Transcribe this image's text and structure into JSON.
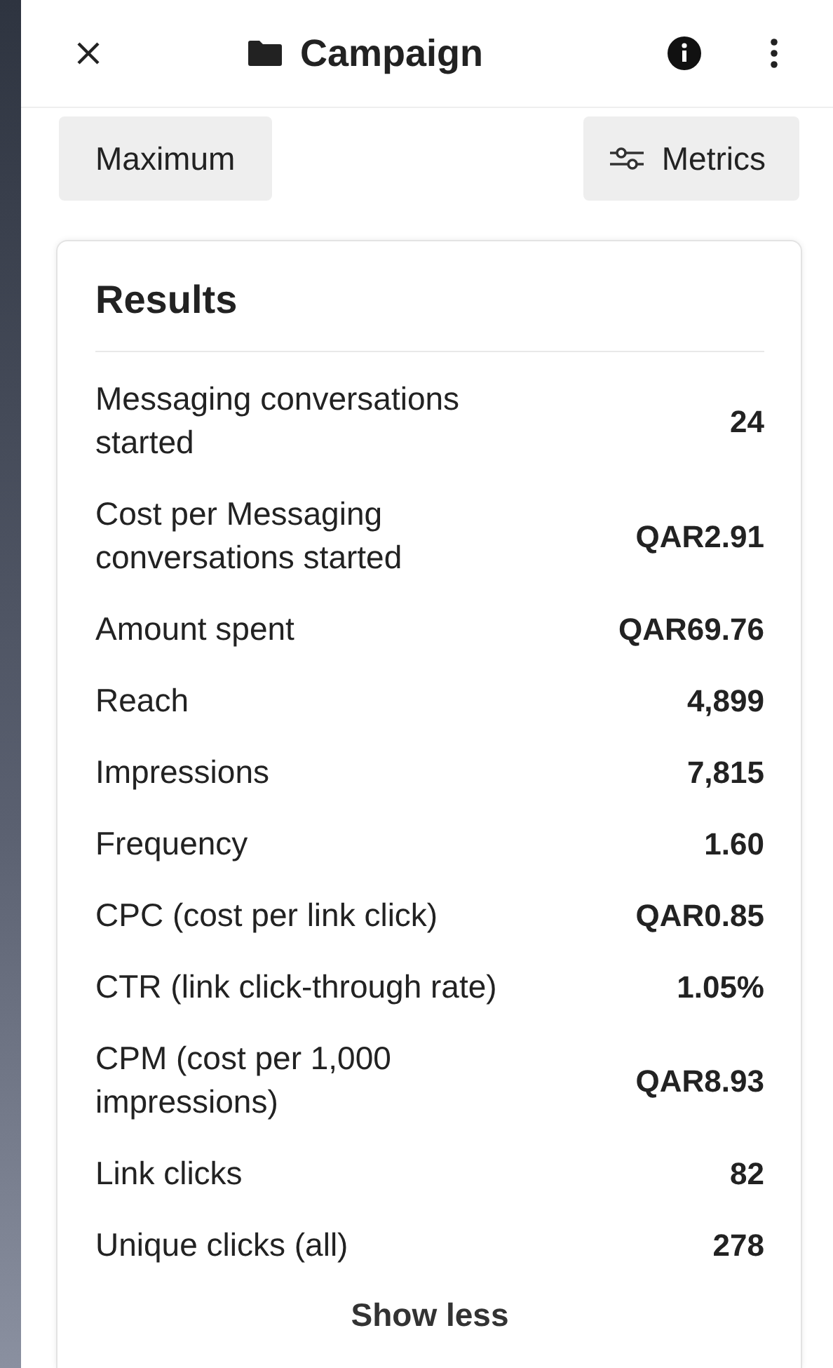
{
  "header": {
    "title": "Campaign"
  },
  "toolbar": {
    "left_button": "Maximum",
    "right_button": "Metrics"
  },
  "results": {
    "title": "Results",
    "rows": [
      {
        "label": "Messaging conversations started",
        "value": "24"
      },
      {
        "label": "Cost per Messaging conversations started",
        "value": "QAR2.91"
      },
      {
        "label": "Amount spent",
        "value": "QAR69.76"
      },
      {
        "label": "Reach",
        "value": "4,899"
      },
      {
        "label": "Impressions",
        "value": "7,815"
      },
      {
        "label": "Frequency",
        "value": "1.60"
      },
      {
        "label": "CPC (cost per link click)",
        "value": "QAR0.85"
      },
      {
        "label": "CTR (link click-through rate)",
        "value": "1.05%"
      },
      {
        "label": "CPM (cost per 1,000 impressions)",
        "value": "QAR8.93"
      },
      {
        "label": "Link clicks",
        "value": "82"
      },
      {
        "label": "Unique clicks (all)",
        "value": "278"
      }
    ],
    "toggle": "Show less"
  }
}
